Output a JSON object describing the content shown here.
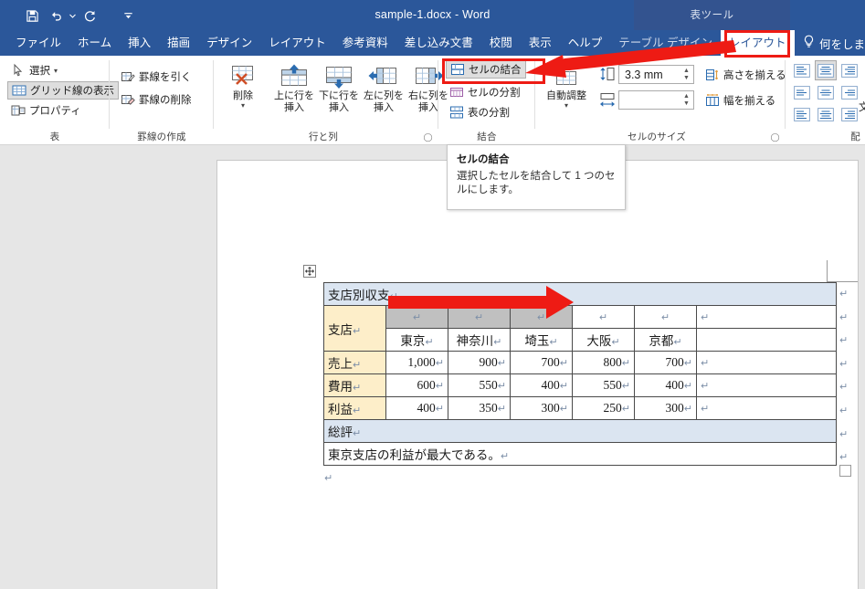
{
  "window": {
    "doc_title": "sample-1.docx  -  Word",
    "contextual_tools_label": "表ツール",
    "quick_access": [
      {
        "name": "save-icon",
        "label": "保存"
      },
      {
        "name": "undo-icon",
        "label": "元に戻す"
      },
      {
        "name": "redo-icon",
        "label": "やり直し"
      },
      {
        "name": "customize-qat-icon",
        "label": "クイック アクセス ツール バーのユーザー設定"
      }
    ]
  },
  "tabs": [
    {
      "label": "ファイル",
      "active": false
    },
    {
      "label": "ホーム",
      "active": false
    },
    {
      "label": "挿入",
      "active": false
    },
    {
      "label": "描画",
      "active": false
    },
    {
      "label": "デザイン",
      "active": false
    },
    {
      "label": "レイアウト",
      "active": false
    },
    {
      "label": "参考資料",
      "active": false
    },
    {
      "label": "差し込み文書",
      "active": false
    },
    {
      "label": "校閲",
      "active": false
    },
    {
      "label": "表示",
      "active": false
    },
    {
      "label": "ヘルプ",
      "active": false
    },
    {
      "label": "テーブル デザイン",
      "active": false
    },
    {
      "label": "レイアウト",
      "active": true
    }
  ],
  "tell_me": {
    "icon": "lightbulb-icon",
    "label": "何をしま"
  },
  "ribbon": {
    "groups": [
      {
        "name": "表",
        "label": "表",
        "items": [
          {
            "label": "選択",
            "icon": "cursor-select-icon",
            "has_dropdown": true
          },
          {
            "label": "グリッド線の表示",
            "icon": "gridlines-icon",
            "selected": true
          },
          {
            "label": "プロパティ",
            "icon": "table-properties-icon"
          }
        ]
      },
      {
        "name": "罫線の作成",
        "label": "罫線の作成",
        "items": [
          {
            "label": "罫線を引く",
            "icon": "draw-border-icon"
          },
          {
            "label": "罫線の削除",
            "icon": "eraser-icon"
          }
        ]
      },
      {
        "name": "行と列",
        "label": "行と列",
        "has_dialog_launcher": true,
        "items": [
          {
            "label": "削除",
            "icon": "delete-table-icon",
            "has_dropdown": true
          },
          {
            "label": "上に行を\n挿入",
            "line1": "上に行を",
            "line2": "挿入",
            "icon": "insert-above-icon"
          },
          {
            "label": "下に行を\n挿入",
            "line1": "下に行を",
            "line2": "挿入",
            "icon": "insert-below-icon"
          },
          {
            "label": "左に列を\n挿入",
            "line1": "左に列を",
            "line2": "挿入",
            "icon": "insert-left-icon"
          },
          {
            "label": "右に列を\n挿入",
            "line1": "右に列を",
            "line2": "挿入",
            "icon": "insert-right-icon"
          }
        ]
      },
      {
        "name": "結合",
        "label": "結合",
        "items": [
          {
            "label": "セルの結合",
            "icon": "merge-cells-icon",
            "highlighted": true
          },
          {
            "label": "セルの分割",
            "icon": "split-cells-icon"
          },
          {
            "label": "表の分割",
            "icon": "split-table-icon"
          }
        ]
      },
      {
        "name": "セルのサイズ",
        "label": "セルのサイズ",
        "has_dialog_launcher": true,
        "items": [
          {
            "label": "自動調整",
            "icon": "autofit-icon",
            "has_dropdown": true
          },
          {
            "label": "高さを揃える",
            "icon": "distribute-rows-icon"
          },
          {
            "label": "幅を揃える",
            "icon": "distribute-columns-icon"
          }
        ],
        "height_field": {
          "name": "row-height",
          "icon": "row-height-icon",
          "value": "3.3 mm"
        },
        "width_field": {
          "name": "column-width",
          "icon": "column-width-icon",
          "value": ""
        }
      },
      {
        "name": "配置",
        "label": "配",
        "items": [
          {
            "icon": "align-top-left-icon",
            "selected": false
          },
          {
            "icon": "align-top-center-icon",
            "selected": true
          },
          {
            "icon": "align-top-right-icon",
            "selected": false
          },
          {
            "icon": "align-middle-left-icon",
            "selected": false
          },
          {
            "icon": "align-middle-center-icon",
            "selected": false
          },
          {
            "icon": "align-middle-right-icon",
            "selected": false
          },
          {
            "icon": "align-bottom-left-icon",
            "selected": false
          },
          {
            "icon": "align-bottom-center-icon",
            "selected": false
          },
          {
            "icon": "align-bottom-right-icon",
            "selected": false
          }
        ],
        "text_direction_label": "文"
      }
    ]
  },
  "tooltip": {
    "title": "セルの結合",
    "body": "選択したセルを結合して 1 つのセルにします。"
  },
  "document": {
    "table": {
      "title_row": "支店別収支",
      "row_label_header": "支店",
      "branches": [
        "東京",
        "神奈川",
        "埼玉",
        "大阪",
        "京都"
      ],
      "rows": [
        {
          "label": "売上",
          "values": [
            "1,000",
            "900",
            "700",
            "800",
            "700"
          ]
        },
        {
          "label": "費用",
          "values": [
            "600",
            "550",
            "400",
            "550",
            "400"
          ]
        },
        {
          "label": "利益",
          "values": [
            "400",
            "350",
            "300",
            "250",
            "300"
          ]
        }
      ],
      "summary_label": "総評",
      "summary_text": "東京支店の利益が最大である。",
      "selected_columns": [
        0,
        1,
        2
      ],
      "paragraph_mark": "↵"
    }
  },
  "annotations": {
    "highlight_color": "#ee1b14",
    "boxes": [
      {
        "name": "merge-cells-highlight",
        "target": "セルの結合"
      },
      {
        "name": "layout-tab-highlight",
        "target": "レイアウト"
      }
    ],
    "arrows": [
      {
        "name": "tab-to-merge-arrow",
        "from": "レイアウト",
        "to": "セルの結合"
      },
      {
        "name": "table-selection-arrow",
        "from": "東京",
        "to": "埼玉"
      }
    ]
  },
  "colors": {
    "title_bar": "#2b579a",
    "contextual_band": "#33538f",
    "table_title_fill": "#dbe5f1",
    "table_header_fill": "#fdeec9",
    "selection_fill": "#c0c0c0",
    "annotation_red": "#ee1b14"
  }
}
